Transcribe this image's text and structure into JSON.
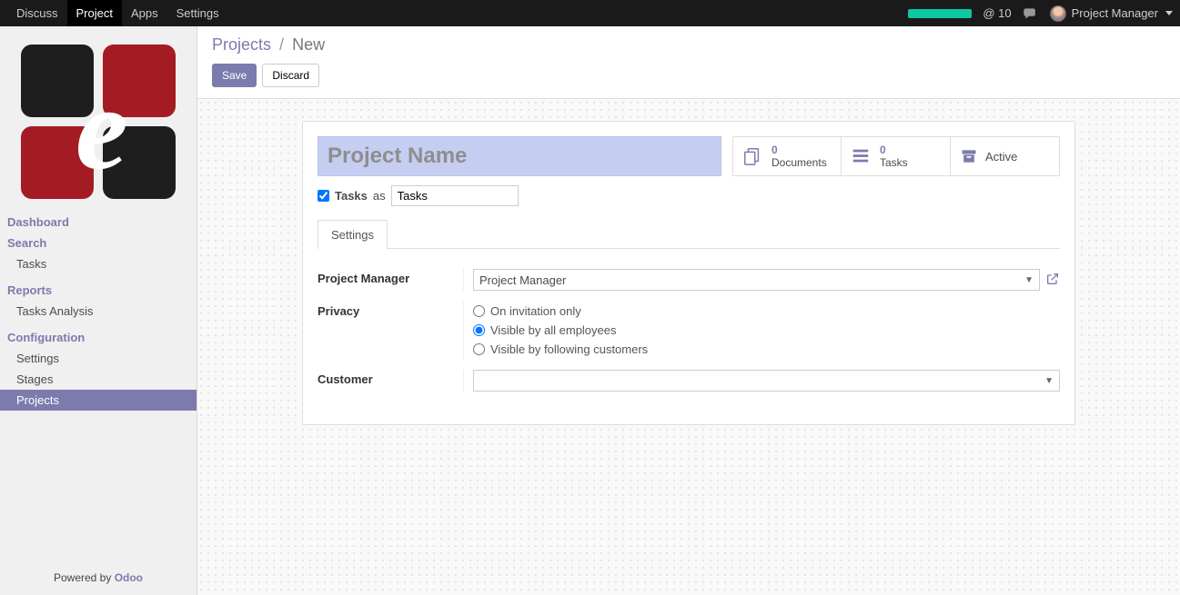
{
  "topnav": {
    "items": [
      "Discuss",
      "Project",
      "Apps",
      "Settings"
    ],
    "active_index": 1,
    "mentions": "@ 10",
    "username": "Project Manager"
  },
  "sidebar": {
    "group1": {
      "header1": "Dashboard",
      "header2": "Search",
      "link_tasks": "Tasks"
    },
    "group2": {
      "header": "Reports",
      "link_tasks_analysis": "Tasks Analysis"
    },
    "group3": {
      "header": "Configuration",
      "link_settings": "Settings",
      "link_stages": "Stages",
      "link_projects": "Projects"
    },
    "footer_text": "Powered by ",
    "footer_brand": "Odoo"
  },
  "breadcrumb": {
    "root": "Projects",
    "current": "New"
  },
  "buttons": {
    "save": "Save",
    "discard": "Discard"
  },
  "form": {
    "title_placeholder": "Project Name",
    "stats": {
      "documents": {
        "count": "0",
        "label": "Documents"
      },
      "tasks": {
        "count": "0",
        "label": "Tasks"
      },
      "active": "Active"
    },
    "tasks_label": "Tasks",
    "tasks_as": "as",
    "tasks_value": "Tasks",
    "tab_settings": "Settings",
    "fields": {
      "manager_label": "Project Manager",
      "manager_value": "Project Manager",
      "privacy_label": "Privacy",
      "privacy_options": {
        "opt1": "On invitation only",
        "opt2": "Visible by all employees",
        "opt3": "Visible by following customers"
      },
      "customer_label": "Customer",
      "customer_value": ""
    }
  }
}
